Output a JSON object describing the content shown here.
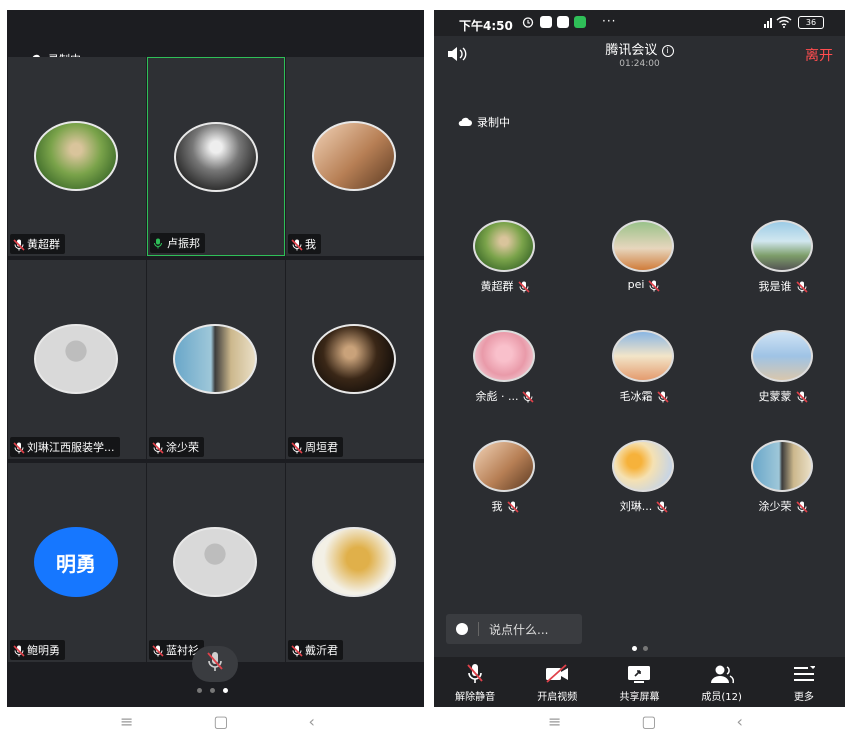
{
  "left": {
    "recording": "录制中",
    "tiles": [
      {
        "name": "黄超群",
        "avatar": "garden"
      },
      {
        "name": "卢振邦",
        "avatar": "bw"
      },
      {
        "name": "我",
        "avatar": "drink"
      },
      {
        "name": "刘琳江西服装学...",
        "avatar": "default"
      },
      {
        "name": "涂少荣",
        "avatar": "sea"
      },
      {
        "name": "周垣君",
        "avatar": "night"
      },
      {
        "name": "鲍明勇",
        "avatar": "text",
        "avatar_text": "明勇"
      },
      {
        "name": "蓝衬衫",
        "avatar": "default"
      },
      {
        "name": "戴沂君",
        "avatar": "leaf"
      }
    ],
    "page_dots": 3
  },
  "right": {
    "status_time": "下午4:50",
    "battery": "36",
    "meeting_title": "腾讯会议",
    "meeting_timer": "01:24:00",
    "leave_label": "离开",
    "recording": "录制中",
    "participants": [
      {
        "name": "黄超群",
        "avatar": "garden"
      },
      {
        "name": "pei",
        "avatar": "food"
      },
      {
        "name": "我是谁",
        "avatar": "street"
      },
      {
        "name": "余彪 · ...",
        "avatar": "pink"
      },
      {
        "name": "毛冰霜",
        "avatar": "flowers"
      },
      {
        "name": "史蒙蒙",
        "avatar": "beach"
      },
      {
        "name": "我",
        "avatar": "drink"
      },
      {
        "name": "刘琳...",
        "avatar": "balloons"
      },
      {
        "name": "涂少荣",
        "avatar": "sea"
      }
    ],
    "chat_placeholder": "说点什么...",
    "toolbar": {
      "unmute": "解除静音",
      "video": "开启视频",
      "share": "共享屏幕",
      "members": "成员(12)",
      "more": "更多"
    }
  },
  "colors": {
    "active_border": "#2fbf58",
    "leave": "#ff4d4f",
    "avatar_text_bg": "#1677ff"
  }
}
